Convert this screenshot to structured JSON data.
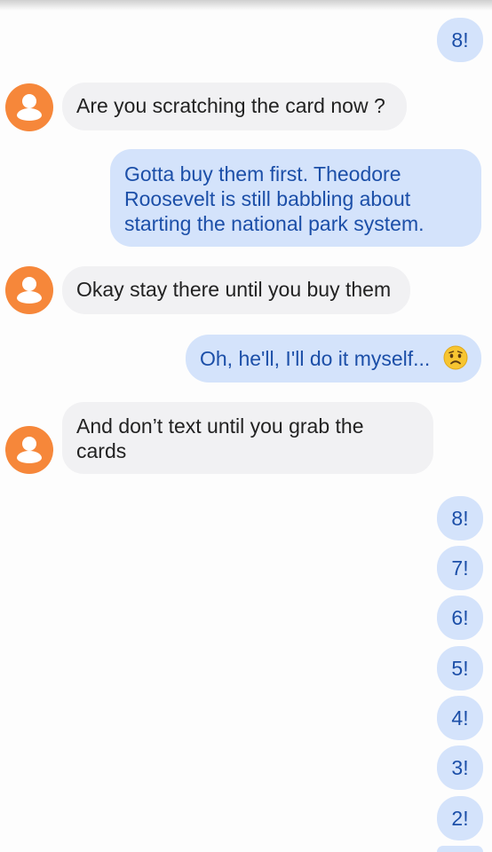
{
  "contact": {
    "avatar_icon": "person-icon",
    "avatar_color": "#f6873a"
  },
  "messages": [
    {
      "dir": "out",
      "text": "8!"
    },
    {
      "dir": "in",
      "text": "Are you scratching the card now ?"
    },
    {
      "dir": "out",
      "lines": [
        "Gotta buy them first.  Theodore",
        "Roosevelt is still babbling about",
        "starting the national park system."
      ]
    },
    {
      "dir": "in",
      "text": "Okay stay there until you buy them"
    },
    {
      "dir": "out",
      "text": "Oh, he'll, I'll do it myself...",
      "emoji": "worried-face-icon"
    },
    {
      "dir": "in",
      "lines": [
        "And don’t text until you grab the",
        "cards"
      ]
    },
    {
      "dir": "out",
      "text": "8!"
    },
    {
      "dir": "out",
      "text": "7!"
    },
    {
      "dir": "out",
      "text": "6!"
    },
    {
      "dir": "out",
      "text": "5!"
    },
    {
      "dir": "out",
      "text": "4!"
    },
    {
      "dir": "out",
      "text": "3!"
    },
    {
      "dir": "out",
      "text": "2!"
    }
  ]
}
